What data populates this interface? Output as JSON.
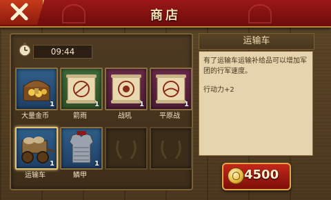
{
  "header": {
    "title": "商店"
  },
  "timer": {
    "value": "09:44"
  },
  "items": [
    {
      "name": "大量金币",
      "count": "1",
      "icon": "treasure-chest-icon"
    },
    {
      "name": "箭雨",
      "count": "1",
      "icon": "arrow-rain-scroll-icon"
    },
    {
      "name": "战吼",
      "count": "1",
      "icon": "warcry-scroll-icon"
    },
    {
      "name": "平原战",
      "count": "1",
      "icon": "plains-battle-scroll-icon"
    },
    {
      "name": "运输车",
      "count": "1",
      "icon": "supply-wagon-icon"
    },
    {
      "name": "鳞甲",
      "count": "1",
      "icon": "scale-armor-icon"
    }
  ],
  "detail": {
    "title": "运输车",
    "description": "有了运输车运输补给品可以增加军团的行军速度。",
    "effect": "行动力+2"
  },
  "buy": {
    "price": "4500",
    "icon": "gold-coin-icon"
  },
  "colors": {
    "header": "#8a1212",
    "selected_border": "#e4c67a",
    "buy_button": "#b3231a"
  }
}
